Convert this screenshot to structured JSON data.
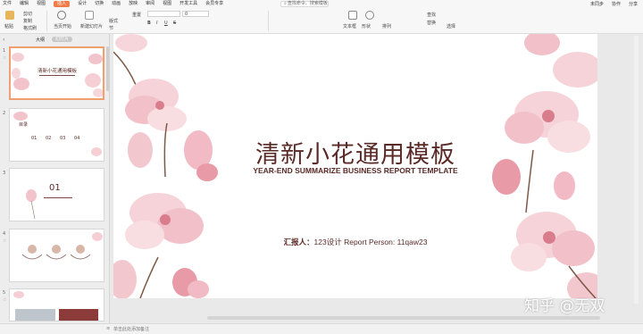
{
  "menubar": {
    "items": [
      "文件",
      "编辑",
      "视图",
      "插入",
      "设计",
      "切换",
      "动画",
      "放映",
      "审阅",
      "视图",
      "开发工具",
      "会员专享"
    ],
    "active_index": 3,
    "search_text": "查找命令、搜索模板",
    "right_items": [
      "未同步",
      "协作",
      "分享"
    ]
  },
  "ribbon": {
    "labels": {
      "paste": "粘贴",
      "cut": "剪切",
      "copy": "复制",
      "format_painter": "格式刷",
      "from_current": "当页开始",
      "new_slide": "新建幻灯片",
      "layout": "版式",
      "section": "节",
      "reset": "重置",
      "font_size": "0",
      "text_box": "文本框",
      "shape": "形状",
      "arrange": "排列",
      "find": "查找",
      "replace": "替换",
      "select": "选择"
    }
  },
  "leftpanel": {
    "tabs": [
      "大纲",
      "幻灯片"
    ],
    "slide_numbers": [
      "1",
      "2",
      "3",
      "4",
      "5"
    ],
    "thumbnails": [
      {
        "title": "清新小花通用模板"
      },
      {
        "title": "目录",
        "items": [
          "01",
          "02",
          "03",
          "04"
        ]
      },
      {
        "title": "01"
      },
      {
        "title": ""
      },
      {
        "title": ""
      }
    ],
    "add_label": "+"
  },
  "slide": {
    "title": "清新小花通用模板",
    "subtitle": "YEAR-END SUMMARIZE BUSINESS REPORT TEMPLATE",
    "reporter_label": "汇报人：",
    "reporter_value": "123设计   Report Person: 11qaw23"
  },
  "statusbar": {
    "note": "单击此处添加备注"
  },
  "watermark": "知乎 @无双",
  "colors": {
    "accent": "#f07c48",
    "title_text": "#5a2a27",
    "petal": "#f4c9cf",
    "petal_dark": "#d97d8c"
  }
}
